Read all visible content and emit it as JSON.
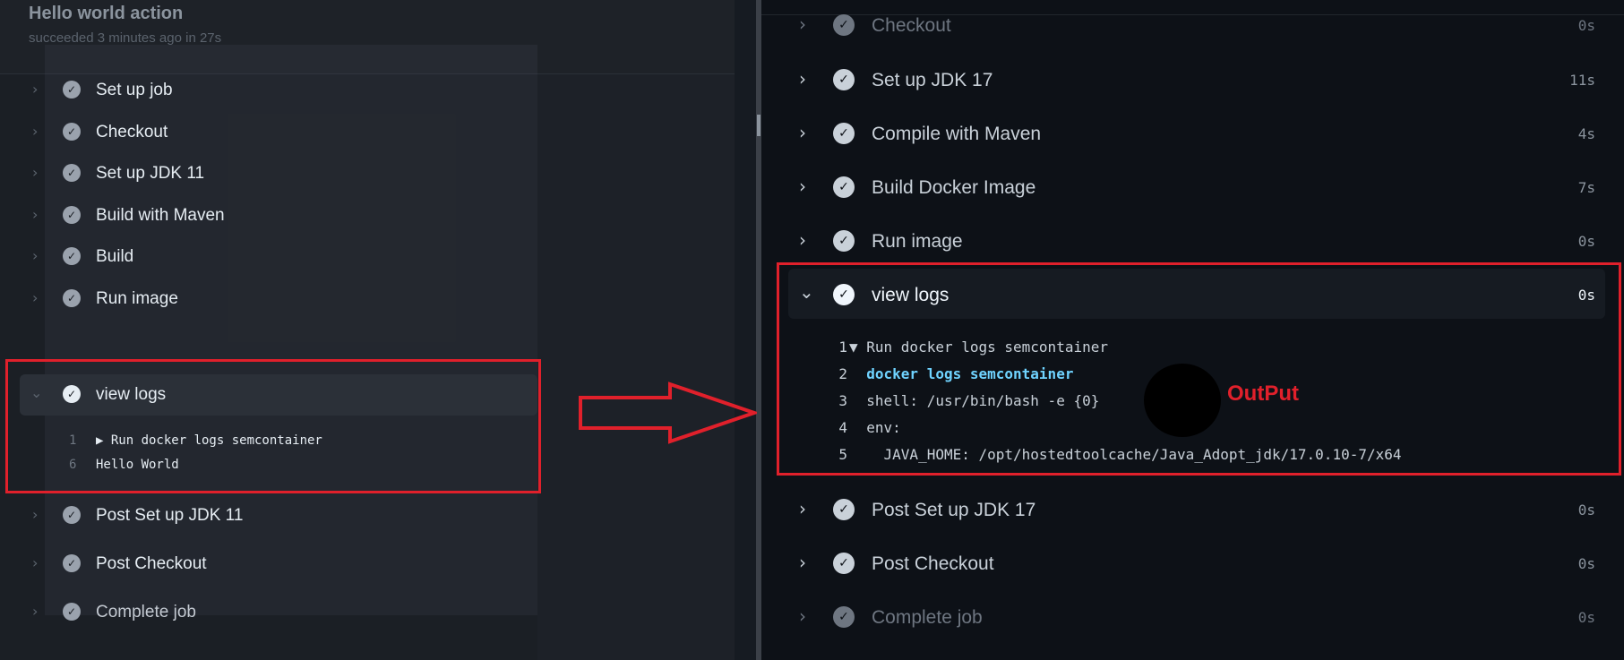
{
  "left_panel": {
    "title": "Hello world action",
    "subtitle": "succeeded 3 minutes ago in 27s",
    "steps": [
      {
        "label": "Set up job"
      },
      {
        "label": "Checkout"
      },
      {
        "label": "Set up JDK 11"
      },
      {
        "label": "Build with Maven"
      },
      {
        "label": "Build"
      },
      {
        "label": "Run image"
      },
      {
        "label": "view logs"
      },
      {
        "label": "Post Set up JDK 11"
      },
      {
        "label": "Post Checkout"
      },
      {
        "label": "Complete job"
      }
    ],
    "log_lines": [
      {
        "num": "1",
        "text": "▶ Run docker logs semcontainer"
      },
      {
        "num": "6",
        "text": "Hello World"
      }
    ]
  },
  "right_panel": {
    "steps": [
      {
        "label": "Checkout",
        "duration": "0s"
      },
      {
        "label": "Set up JDK 17",
        "duration": "11s"
      },
      {
        "label": "Compile with Maven",
        "duration": "4s"
      },
      {
        "label": "Build Docker Image",
        "duration": "7s"
      },
      {
        "label": "Run image",
        "duration": "0s"
      },
      {
        "label": "view logs",
        "duration": "0s"
      },
      {
        "label": "Post Set up JDK 17",
        "duration": "0s"
      },
      {
        "label": "Post Checkout",
        "duration": "0s"
      },
      {
        "label": "Complete job",
        "duration": "0s"
      }
    ],
    "log_lines": [
      {
        "num": "1",
        "text": "▼ Run docker logs semcontainer"
      },
      {
        "num": "2",
        "text": "  docker logs semcontainer"
      },
      {
        "num": "3",
        "text": "  shell: /usr/bin/bash -e {0}"
      },
      {
        "num": "4",
        "text": "  env:"
      },
      {
        "num": "5",
        "text": "    JAVA_HOME: /opt/hostedtoolcache/Java_Adopt_jdk/17.0.10-7/x64"
      }
    ]
  },
  "annotation": {
    "output_label": "OutPut",
    "color": "#e0202b"
  },
  "icons": {
    "collapsed": "chevron-right-icon",
    "expanded": "chevron-down-icon",
    "status": "check-circle-icon"
  }
}
